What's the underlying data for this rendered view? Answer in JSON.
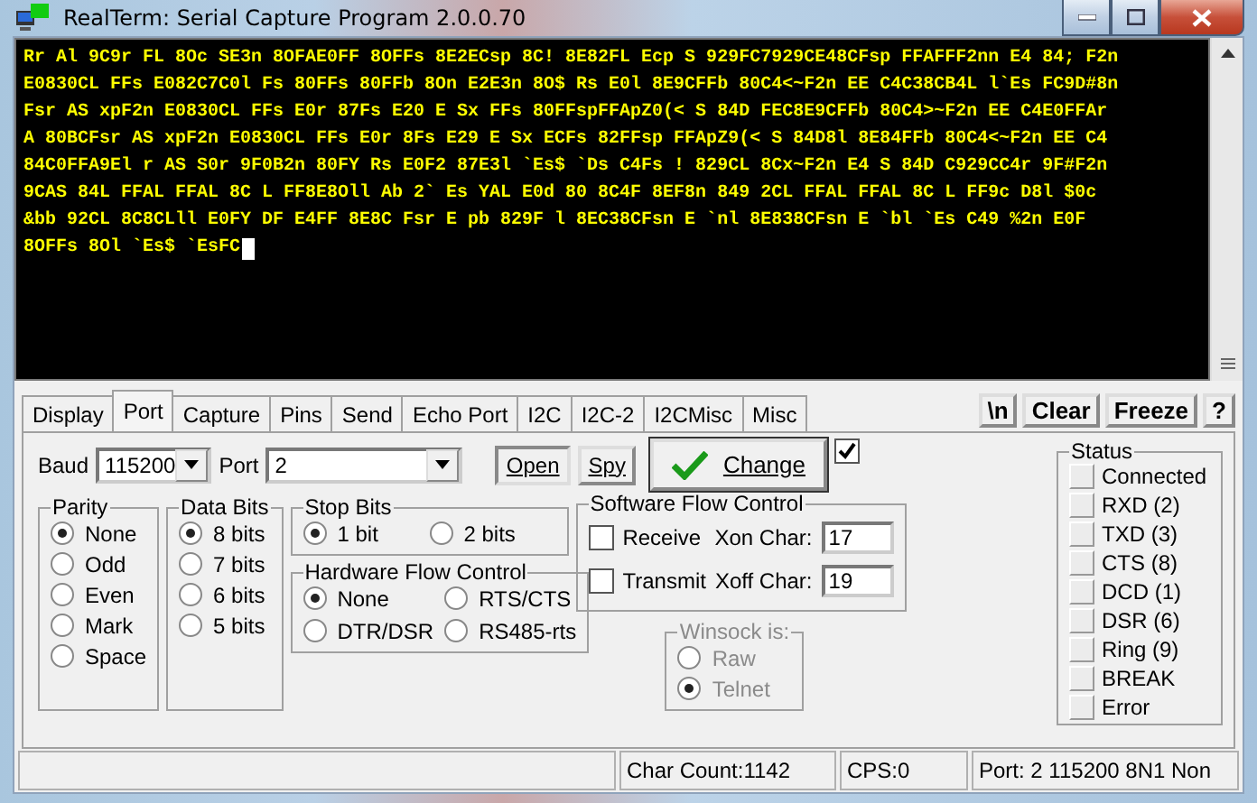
{
  "window": {
    "title": "RealTerm: Serial Capture Program 2.0.0.70"
  },
  "terminal": {
    "lines": [
      "Rr Al 9C9r FL 8Oc SE3n 8OFAE0FF 8OFFs 8E2ECsp 8C! 8E82FL Ecp S 929FC7929CE48CFsp FFAFFF2nn E4 84; F2n",
      "E0830CL FFs E082C7C0l Fs 80FFs 80FFb 8On E2E3n 8O$ Rs E0l 8E9CFFb 80C4<~F2n EE C4C38CB4L l`Es FC9D#8n",
      "Fsr AS xpF2n E0830CL FFs E0r 87Fs E20 E Sx FFs 80FFspFFApZ0(< S 84D FEC8E9CFFb 80C4>~F2n EE C4E0FFAr",
      "A 80BCFsr AS xpF2n E0830CL FFs E0r 8Fs E29 E Sx ECFs 82FFsp FFApZ9(< S 84D8l 8E84FFb 80C4<~F2n EE C4",
      "84C0FFA9El r AS S0r 9F0B2n 80FY Rs E0F2 87E3l `Es$ `Ds C4Fs ! 829CL 8Cx~F2n E4 S 84D C929CC4r 9F#F2n",
      "9CAS 84L FFAL FFAL 8C L FF8E8Oll Ab 2` Es YAL E0d 80 8C4F 8EF8n 849 2CL FFAL FFAL 8C L FF9c D8l $0c",
      "&bb 92CL 8C8CLll E0FY DF E4FF 8E8C Fsr E pb 829F l 8EC38CFsn E `nl 8E838CFsn E `bl `Es C49 %2n E0F",
      "8OFFs 8Ol `Es$ `EsFC"
    ]
  },
  "tabs": [
    {
      "label": "Display",
      "selected": false
    },
    {
      "label": "Port",
      "selected": true
    },
    {
      "label": "Capture",
      "selected": false
    },
    {
      "label": "Pins",
      "selected": false
    },
    {
      "label": "Send",
      "selected": false
    },
    {
      "label": "Echo Port",
      "selected": false
    },
    {
      "label": "I2C",
      "selected": false
    },
    {
      "label": "I2C-2",
      "selected": false
    },
    {
      "label": "I2CMisc",
      "selected": false
    },
    {
      "label": "Misc",
      "selected": false
    }
  ],
  "tool_buttons": [
    "\\n",
    "Clear",
    "Freeze",
    "?"
  ],
  "baud": {
    "label": "Baud",
    "value": "115200"
  },
  "port": {
    "label": "Port",
    "value": "2"
  },
  "open_button": {
    "label": "Open",
    "pressed": true
  },
  "spy_button": {
    "label": "Spy",
    "pressed": false
  },
  "change_button": {
    "label": "Change"
  },
  "change_checkbox": {
    "checked": true
  },
  "parity": {
    "title": "Parity",
    "options": [
      {
        "label": "None",
        "selected": true
      },
      {
        "label": "Odd",
        "selected": false
      },
      {
        "label": "Even",
        "selected": false
      },
      {
        "label": "Mark",
        "selected": false
      },
      {
        "label": "Space",
        "selected": false
      }
    ]
  },
  "data_bits": {
    "title": "Data Bits",
    "options": [
      {
        "label": "8 bits",
        "selected": true
      },
      {
        "label": "7 bits",
        "selected": false
      },
      {
        "label": "6 bits",
        "selected": false
      },
      {
        "label": "5 bits",
        "selected": false
      }
    ]
  },
  "stop_bits": {
    "title": "Stop Bits",
    "options": [
      {
        "label": "1 bit",
        "selected": true
      },
      {
        "label": "2 bits",
        "selected": false
      }
    ]
  },
  "hardware_flow": {
    "title": "Hardware Flow Control",
    "options": [
      {
        "label": "None",
        "selected": true
      },
      {
        "label": "RTS/CTS",
        "selected": false
      },
      {
        "label": "DTR/DSR",
        "selected": false
      },
      {
        "label": "RS485-rts",
        "selected": false
      }
    ]
  },
  "software_flow": {
    "title": "Software Flow Control",
    "rows": [
      {
        "label": "Receive",
        "checked": false,
        "char_label": "Xon Char:",
        "char_value": "17"
      },
      {
        "label": "Transmit",
        "checked": false,
        "char_label": "Xoff Char:",
        "char_value": "19"
      }
    ]
  },
  "winsock": {
    "title": "Winsock is:",
    "disabled": true,
    "options": [
      {
        "label": "Raw",
        "selected": false
      },
      {
        "label": "Telnet",
        "selected": true
      }
    ]
  },
  "status": {
    "title": "Status",
    "items": [
      {
        "label": "Connected",
        "on": false
      },
      {
        "label": "RXD (2)",
        "on": false
      },
      {
        "label": "TXD (3)",
        "on": false
      },
      {
        "label": "CTS (8)",
        "on": false
      },
      {
        "label": "DCD (1)",
        "on": false
      },
      {
        "label": "DSR (6)",
        "on": false
      },
      {
        "label": "Ring (9)",
        "on": false
      },
      {
        "label": "BREAK",
        "on": false
      },
      {
        "label": "Error",
        "on": false
      }
    ]
  },
  "status_bar": [
    "Char Count:1142",
    "CPS:0",
    "Port: 2 115200 8N1 Non"
  ]
}
